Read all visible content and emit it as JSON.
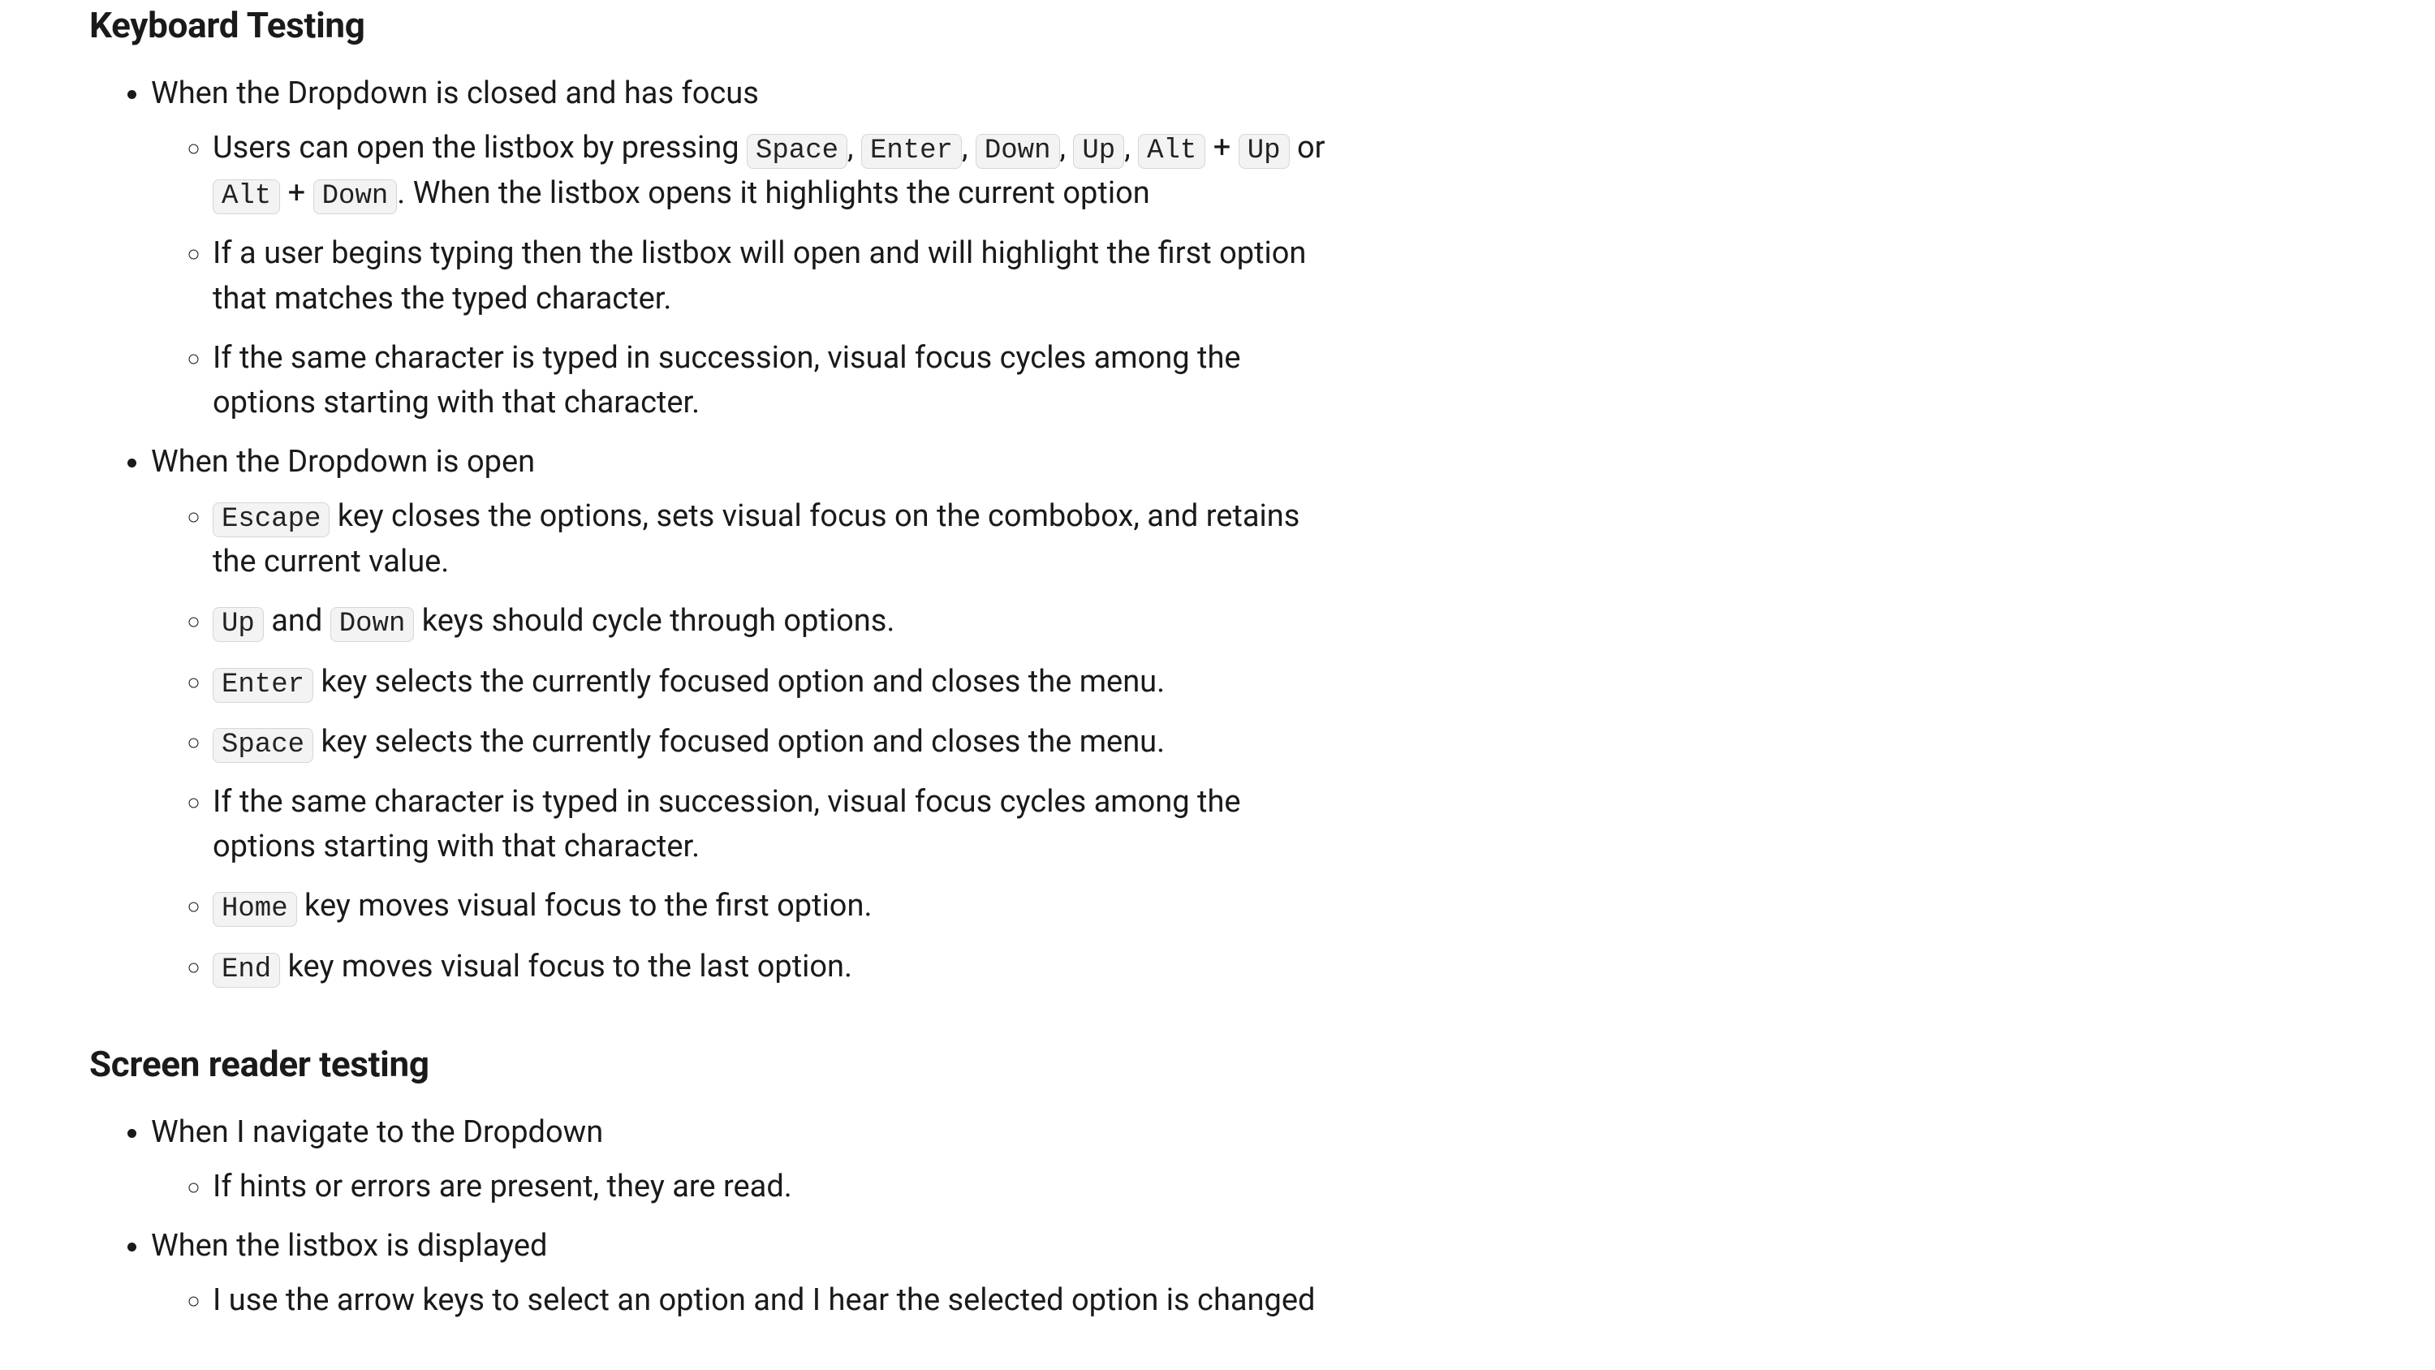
{
  "sections": {
    "keyboard": {
      "heading": "Keyboard Testing",
      "closed": {
        "title": "When the Dropdown is closed and has focus",
        "items": {
          "open": {
            "pre": "Users can open the listbox by pressing ",
            "k_space": "Space",
            "sep1": ", ",
            "k_enter": "Enter",
            "sep2": ", ",
            "k_down": "Down",
            "sep3": ", ",
            "k_up": "Up",
            "sep4": ", ",
            "k_alt1": "Alt",
            "plus1": " + ",
            "k_up2": "Up",
            "or": " or ",
            "k_alt2": "Alt",
            "plus2": " + ",
            "k_down2": "Down",
            "post": ". When the listbox opens it highlights the current option"
          },
          "typing": "If a user begins typing then the listbox will open and will highlight the first option that matches the typed character.",
          "samechar": "If the same character is typed in succession, visual focus cycles among the options starting with that character."
        }
      },
      "open": {
        "title": "When the Dropdown is open",
        "items": {
          "escape": {
            "k": "Escape",
            "text": " key closes the options, sets visual focus on the combobox, and retains the current value."
          },
          "updown": {
            "k_up": "Up",
            "and": " and ",
            "k_down": "Down",
            "text": " keys should cycle through options."
          },
          "enter": {
            "k": "Enter",
            "text": " key selects the currently focused option and closes the menu."
          },
          "space": {
            "k": "Space",
            "text": " key selects the currently focused option and closes the menu."
          },
          "samechar": "If the same character is typed in succession, visual focus cycles among the options starting with that character.",
          "home": {
            "k": "Home",
            "text": " key moves visual focus to the first option."
          },
          "end": {
            "k": "End",
            "text": " key moves visual focus to the last option."
          }
        }
      }
    },
    "screenreader": {
      "heading": "Screen reader testing",
      "nav": {
        "title": "When I navigate to the Dropdown",
        "items": {
          "hints": "If hints or errors are present, they are read."
        }
      },
      "listbox": {
        "title": "When the listbox is displayed",
        "items": {
          "arrow": "I use the arrow keys to select an option and I hear the selected option is changed"
        }
      }
    }
  }
}
